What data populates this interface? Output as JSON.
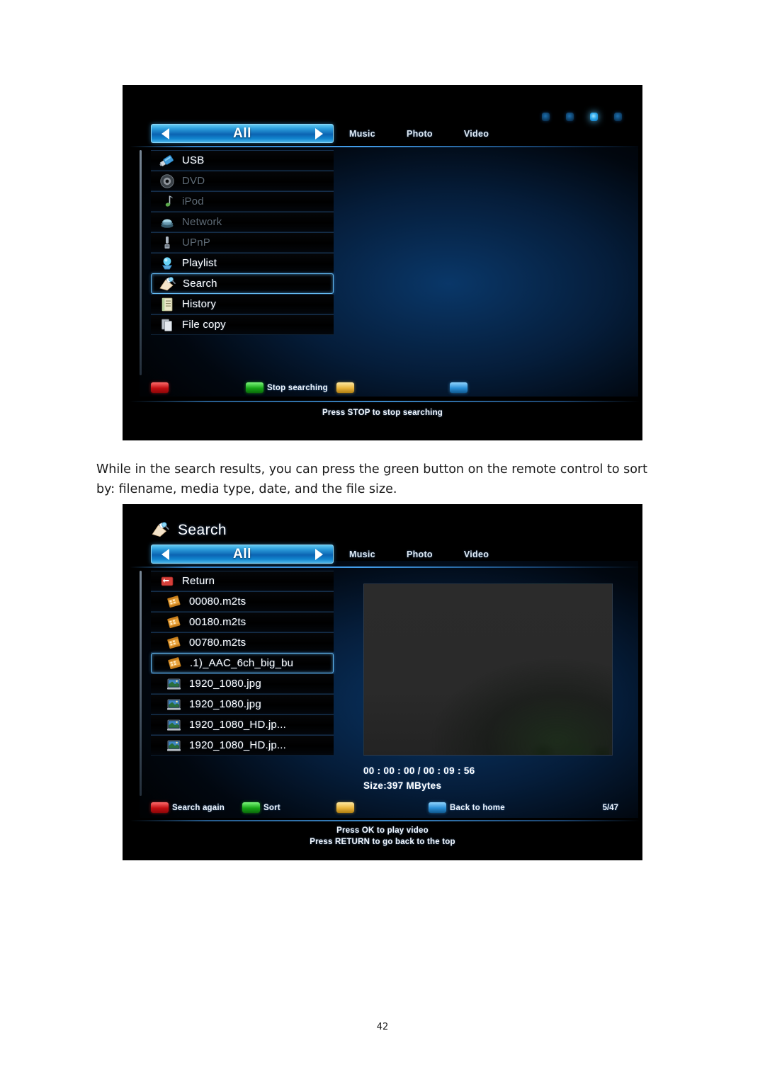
{
  "document": {
    "paragraph": "While in the search results, you can press the green button on the remote control to sort by: filename, media type, date, and the file size.",
    "page_number": "42"
  },
  "screen_one": {
    "filter": {
      "selected": "All",
      "tabs": [
        "Music",
        "Photo",
        "Video"
      ]
    },
    "indicator_dots": {
      "count": 4,
      "active_index": 2
    },
    "menu_items": [
      {
        "label": "USB",
        "icon": "usb-drive-icon",
        "state": "enabled"
      },
      {
        "label": "DVD",
        "icon": "disc-icon",
        "state": "disabled"
      },
      {
        "label": "iPod",
        "icon": "music-note-icon",
        "state": "disabled"
      },
      {
        "label": "Network",
        "icon": "network-icon",
        "state": "disabled"
      },
      {
        "label": "UPnP",
        "icon": "upnp-icon",
        "state": "disabled"
      },
      {
        "label": "Playlist",
        "icon": "playlist-icon",
        "state": "enabled"
      },
      {
        "label": "Search",
        "icon": "search-icon",
        "state": "selected"
      },
      {
        "label": "History",
        "icon": "history-icon",
        "state": "enabled"
      },
      {
        "label": "File copy",
        "icon": "file-copy-icon",
        "state": "enabled"
      }
    ],
    "color_keys": [
      {
        "color": "red",
        "label": ""
      },
      {
        "color": "green",
        "label": "Stop searching"
      },
      {
        "color": "yellow",
        "label": ""
      },
      {
        "color": "blue",
        "label": ""
      }
    ],
    "hint_lines": [
      "Press STOP to stop searching"
    ]
  },
  "screen_two": {
    "title": "Search",
    "title_icon": "search-icon",
    "filter": {
      "selected": "All",
      "tabs": [
        "Music",
        "Photo",
        "Video"
      ]
    },
    "file_items": [
      {
        "label": "Return",
        "icon": "return-icon",
        "state": "enabled",
        "indent": false
      },
      {
        "label": "00080.m2ts",
        "icon": "video-file-icon",
        "state": "enabled",
        "indent": true
      },
      {
        "label": "00180.m2ts",
        "icon": "video-file-icon",
        "state": "enabled",
        "indent": true
      },
      {
        "label": "00780.m2ts",
        "icon": "video-file-icon",
        "state": "enabled",
        "indent": true
      },
      {
        "label": ".1)_AAC_6ch_big_bu",
        "icon": "video-file-icon",
        "state": "selected",
        "indent": true
      },
      {
        "label": "1920_1080.jpg",
        "icon": "photo-file-icon",
        "state": "enabled",
        "indent": true
      },
      {
        "label": "1920_1080.jpg",
        "icon": "photo-file-icon",
        "state": "enabled",
        "indent": true
      },
      {
        "label": "1920_1080_HD.jp...",
        "icon": "photo-file-icon",
        "state": "enabled",
        "indent": true
      },
      {
        "label": "1920_1080_HD.jp...",
        "icon": "photo-file-icon",
        "state": "enabled",
        "indent": true
      }
    ],
    "preview": {
      "time": "00 : 00 : 00  /  00 : 09 : 56",
      "size": "Size:397 MBytes"
    },
    "color_keys": [
      {
        "color": "red",
        "label": "Search again"
      },
      {
        "color": "green",
        "label": "Sort"
      },
      {
        "color": "yellow",
        "label": ""
      },
      {
        "color": "blue",
        "label": "Back to home"
      }
    ],
    "counter": "5/47",
    "hint_lines": [
      "Press OK to play video",
      "Press RETURN to go back to the top"
    ]
  },
  "colors": {
    "accent_blue": "#2d9fdd",
    "pill_highlight": "#63c9f2",
    "selection_border": "#63b8ef",
    "key_red": "#c20f12",
    "key_green": "#17a617",
    "key_yellow": "#e9b43c",
    "key_blue": "#2a8fd6"
  }
}
